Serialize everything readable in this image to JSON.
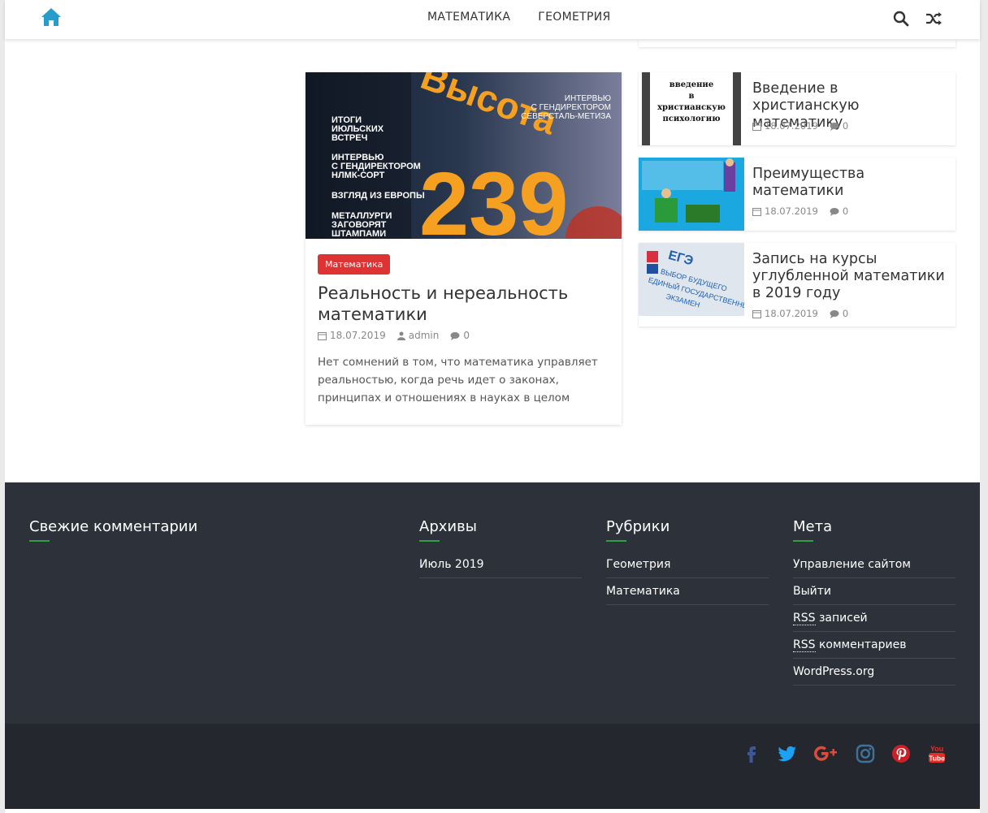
{
  "header": {
    "nav": [
      {
        "label": "МАТЕМАТИКА"
      },
      {
        "label": "ГЕОМЕТРИЯ"
      }
    ],
    "icons": {
      "home": "home-icon",
      "search": "search-icon",
      "random": "shuffle-icon"
    },
    "accent": "#289dcc"
  },
  "featured": {
    "image_text": {
      "big": "239",
      "word": "Высота",
      "lines_left": [
        "ИТОГИ",
        "ИЮЛЬСКИХ",
        "ВСТРЕЧ",
        "ИНТЕРВЬЮ",
        "С ГЕНДИРЕКТОРОМ",
        "НЛМК-СОРТ",
        "ВЗГЛЯД ИЗ ЕВРОПЫ",
        "МЕТАЛЛУРГИ",
        "ЗАГОВОРЯТ",
        "ШТАМПАМИ"
      ],
      "lines_right": [
        "ИНТЕРВЬЮ",
        "С ГЕНДИРЕКТОРОМ",
        "СЕВЕРСТАЛЬ-МЕТИЗА"
      ]
    },
    "category": "Математика",
    "title": "Реальность и нереальность математики",
    "date": "18.07.2019",
    "author": "admin",
    "comments": "0",
    "excerpt": "Нет сомнений в том, что математика управляет реальностью, когда речь идет о законах, принципах и отношениях в науках в целом"
  },
  "side_posts": [
    {
      "title": "Введение в христианскую математику",
      "date": "18.07.2019",
      "comments": "0",
      "thumb_text": [
        "введение",
        "в",
        "христианскую",
        "психологию"
      ]
    },
    {
      "title": "Преимущества математики",
      "date": "18.07.2019",
      "comments": "0"
    },
    {
      "title": "Запись на курсы углубленной математики в 2019 году",
      "date": "18.07.2019",
      "comments": "0",
      "thumb_text": [
        "ЕГЭ",
        "ВЫБОР БУДУЩЕГО",
        "ЕДИНЫЙ ГОСУДАРСТВЕННЫЙ",
        "ЭКЗАМЕН"
      ]
    }
  ],
  "footer": {
    "comments_title": "Свежие комментарии",
    "archives_title": "Архивы",
    "archives": [
      "Июль 2019"
    ],
    "categories_title": "Рубрики",
    "categories": [
      "Геометрия",
      "Математика"
    ],
    "meta_title": "Мета",
    "meta": {
      "admin": "Управление сайтом",
      "logout": "Выйти",
      "rss_abbr": "RSS",
      "rss_posts": " записей",
      "rss_comments": " комментариев",
      "wordpress": "WordPress.org"
    },
    "underline_color": "#2f9e44"
  },
  "social": [
    "facebook-icon",
    "twitter-icon",
    "google-plus-icon",
    "instagram-icon",
    "pinterest-icon",
    "youtube-icon"
  ]
}
